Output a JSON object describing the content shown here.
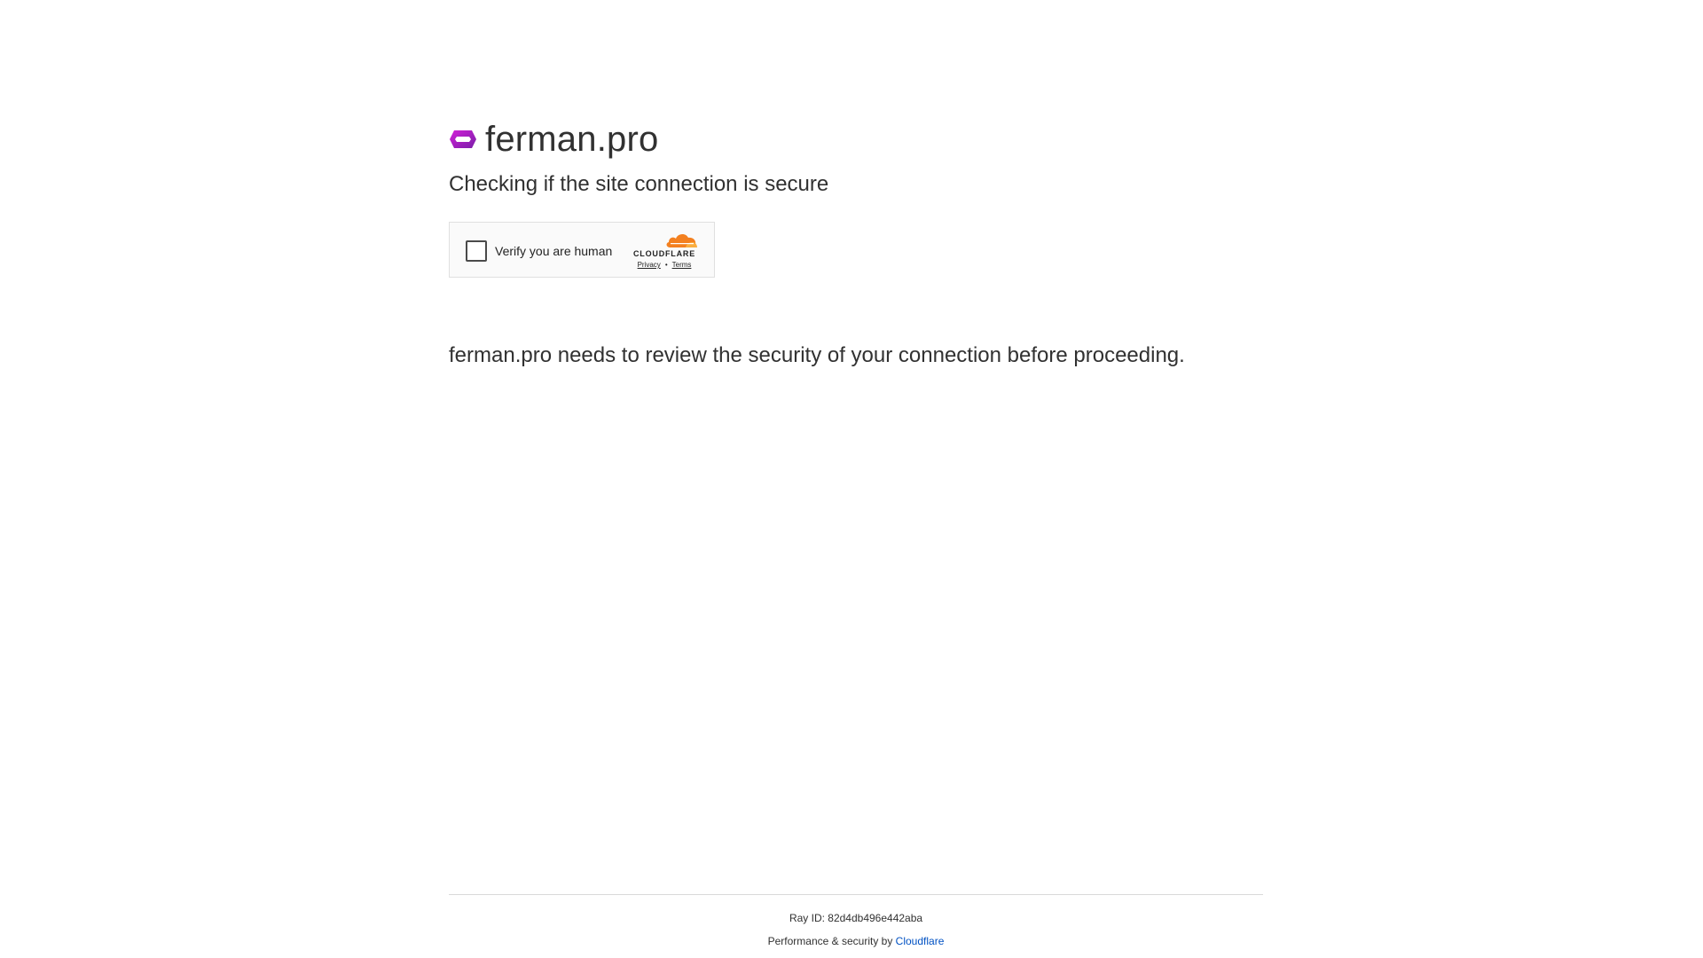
{
  "site": {
    "domain": "ferman.pro",
    "subtitle": "Checking if the site connection is secure",
    "favicon_icon": "ferman-logo-icon"
  },
  "widget": {
    "verify_label": "Verify you are human",
    "brand": "CLOUDFLARE",
    "privacy_label": "Privacy",
    "separator": "•",
    "terms_label": "Terms",
    "brand_color": "#f38020"
  },
  "message": "ferman.pro needs to review the security of your connection before proceeding.",
  "footer": {
    "ray_id": "Ray ID: 82d4db496e442aba",
    "performance_prefix": "Performance & security by",
    "cloudflare_link": "Cloudflare",
    "link_color": "#0051c3"
  }
}
